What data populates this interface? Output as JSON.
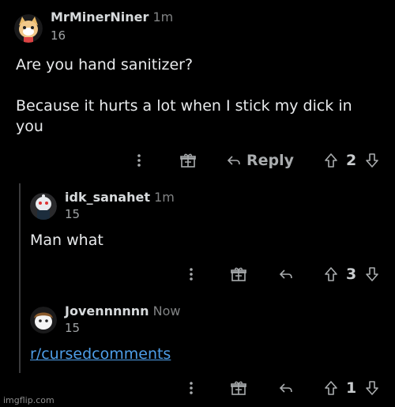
{
  "comments": [
    {
      "author": "MrMinerNiner",
      "time": "1m",
      "score": "16",
      "body_line1": "Are you hand sanitizer?",
      "body_line2": "Because it hurts a lot when I stick my dick in",
      "body_line3": "you",
      "reply_label": "Reply",
      "vote_count": "2",
      "avatar_icon": "snoo-cat-avatar-icon"
    },
    {
      "author": "idk_sanahet",
      "time": "1m",
      "score": "15",
      "body": "Man what",
      "vote_count": "3",
      "avatar_icon": "snoo-dark-avatar-icon"
    },
    {
      "author": "Jovennnnnn",
      "time": "Now",
      "score": "15",
      "body_link": "r/cursedcomments",
      "vote_count": "1",
      "avatar_icon": "snoo-brown-hair-avatar-icon"
    }
  ],
  "watermark": "imgflip.com",
  "colors": {
    "background": "#000000",
    "text": "#d7dadc",
    "muted": "#818384",
    "link": "#4e9ee8",
    "thread_line": "#3a3a3c"
  }
}
